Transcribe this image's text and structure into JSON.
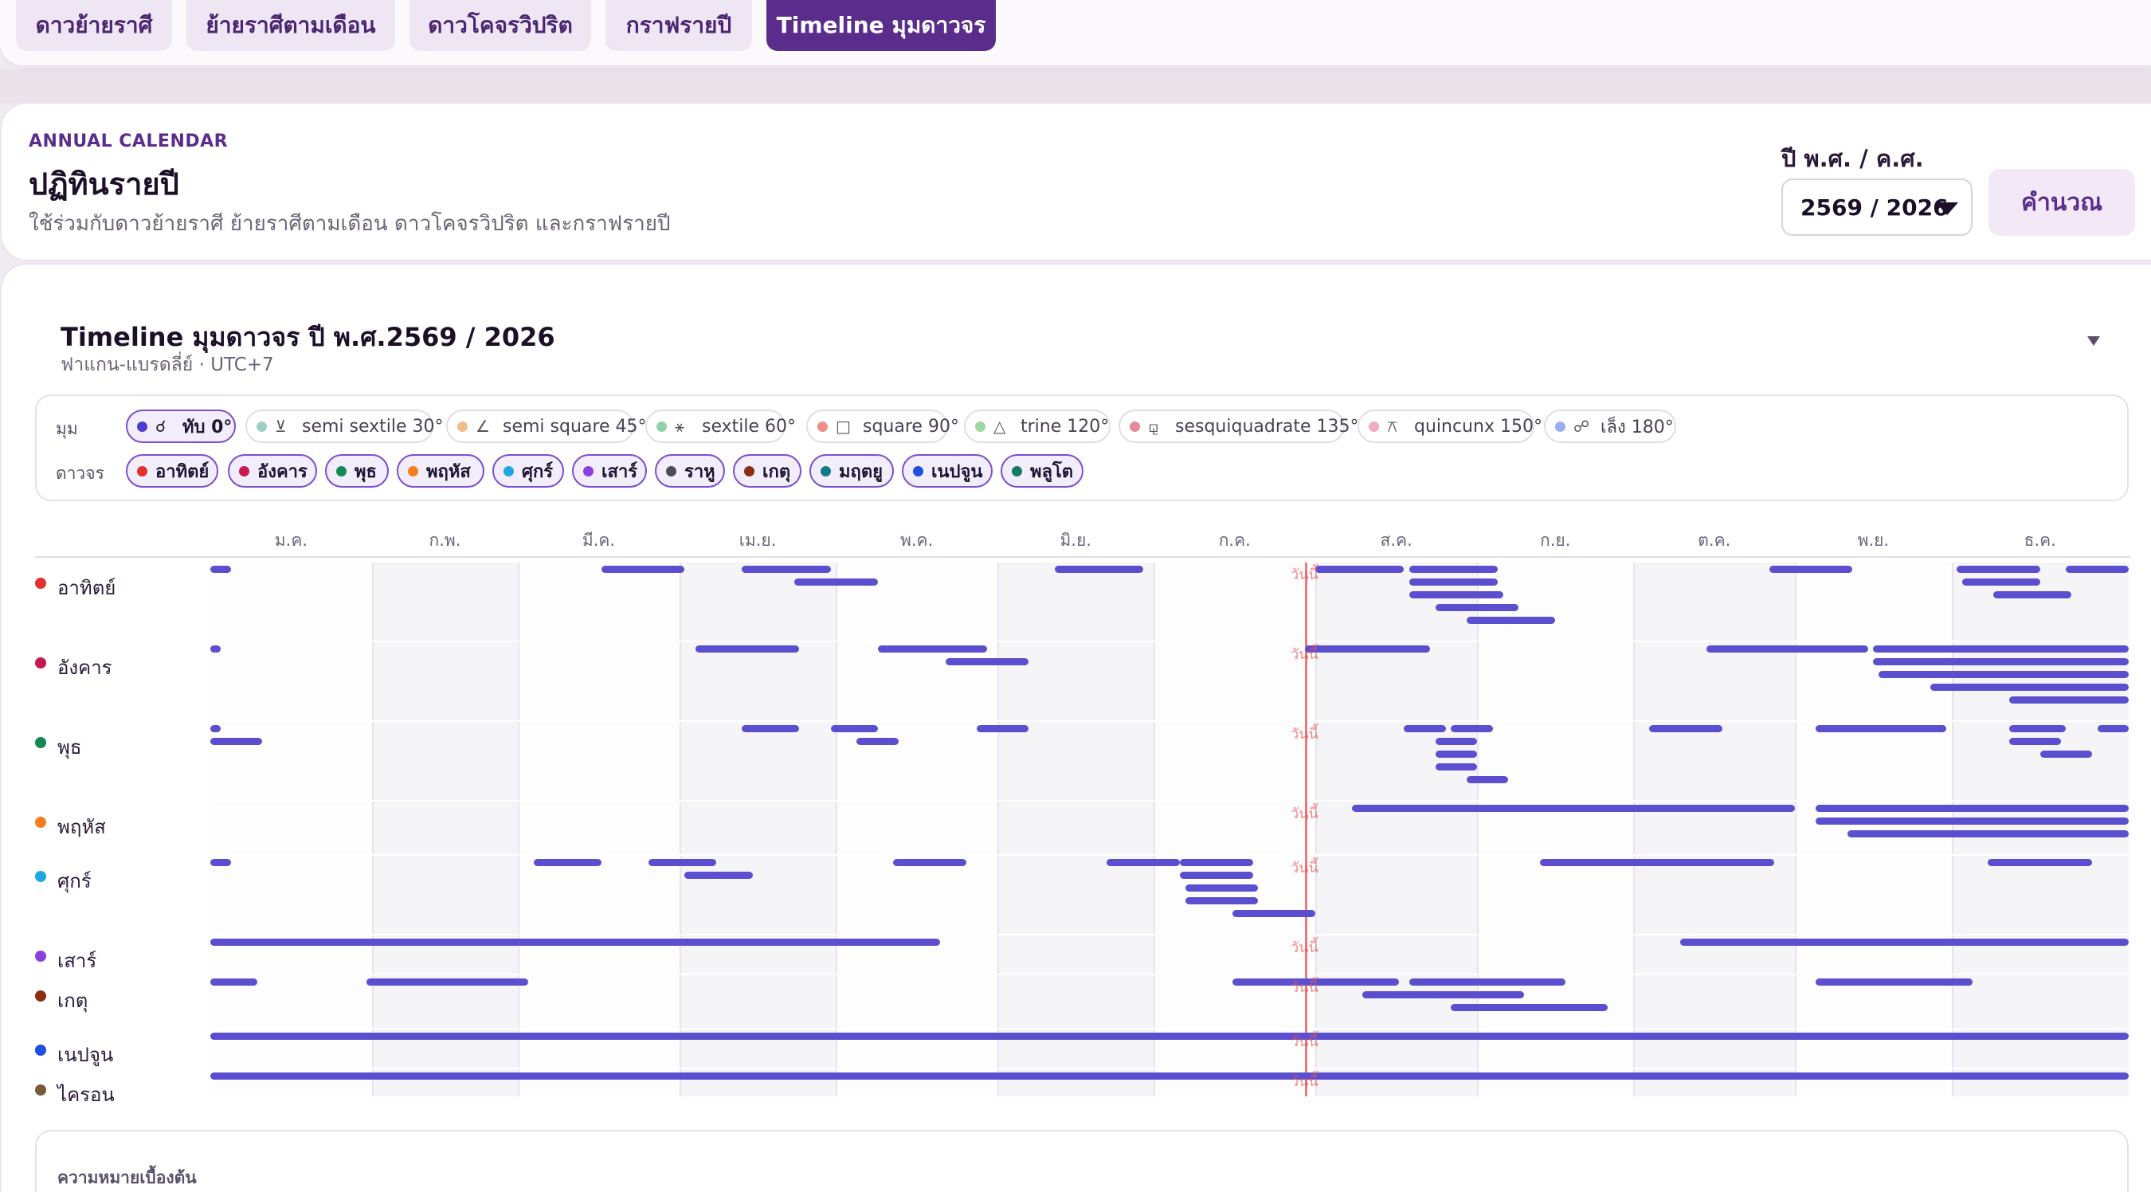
{
  "tabs": [
    {
      "label": "ดาวย้ายราศี",
      "active": false
    },
    {
      "label": "ย้ายราศีตามเดือน",
      "active": false
    },
    {
      "label": "ดาวโคจรวิปริต",
      "active": false
    },
    {
      "label": "กราฟรายปี",
      "active": false
    },
    {
      "label": "Timeline มุมดาวจร",
      "active": true
    }
  ],
  "header": {
    "eyebrow": "ANNUAL CALENDAR",
    "title": "ปฏิทินรายปี",
    "subtitle": "ใช้ร่วมกับดาวย้ายราศี ย้ายราศีตามเดือน ดาวโคจรวิปริต และกราฟรายปี",
    "year_label": "ปี พ.ศ. / ค.ศ.",
    "year_value": "2569 / 2026",
    "calc_button": "คำนวณ"
  },
  "timeline": {
    "title": "Timeline มุมดาวจร ปี พ.ศ.2569 / 2026",
    "subtitle": "ฟาแกน-แบรดลี่ย์ · UTC+7",
    "today_label": "วันนี้",
    "bar_color": "#5b4fcf",
    "today_color": "#e8575a"
  },
  "filters": {
    "aspect_label": "มุม",
    "planet_label": "ดาวจร",
    "aspects": [
      {
        "label": "ทับ 0°",
        "symbol": "☌",
        "color": "#4b3bd1",
        "selected": true
      },
      {
        "label": "semi sextile 30°",
        "symbol": "⊻",
        "color": "#9fd0c4",
        "selected": false
      },
      {
        "label": "semi square 45°",
        "symbol": "∠",
        "color": "#f2bc8c",
        "selected": false
      },
      {
        "label": "sextile 60°",
        "symbol": "⚹",
        "color": "#8fd2a8",
        "selected": false
      },
      {
        "label": "square 90°",
        "symbol": "□",
        "color": "#ef8f86",
        "selected": false
      },
      {
        "label": "trine 120°",
        "symbol": "△",
        "color": "#9ed7a2",
        "selected": false
      },
      {
        "label": "sesquiquadrate 135°",
        "symbol": "⚼",
        "color": "#e38a98",
        "selected": false
      },
      {
        "label": "quincunx 150°",
        "symbol": "⚻",
        "color": "#f5a7c6",
        "selected": false
      },
      {
        "label": "เล็ง 180°",
        "symbol": "☍",
        "color": "#9aaef0",
        "selected": false
      }
    ],
    "planets": [
      {
        "label": "อาทิตย์",
        "color": "#e0322b"
      },
      {
        "label": "อังคาร",
        "color": "#c8174e"
      },
      {
        "label": "พุธ",
        "color": "#138a52"
      },
      {
        "label": "พฤหัส",
        "color": "#f57f1f"
      },
      {
        "label": "ศุกร์",
        "color": "#1ea7e1"
      },
      {
        "label": "เสาร์",
        "color": "#8a3fe0"
      },
      {
        "label": "ราหู",
        "color": "#4b4b55"
      },
      {
        "label": "เกตุ",
        "color": "#8a2d12"
      },
      {
        "label": "มฤตยู",
        "color": "#137a8c"
      },
      {
        "label": "เนปจูน",
        "color": "#1f4fe0"
      },
      {
        "label": "พลูโต",
        "color": "#137a62"
      }
    ]
  },
  "chart_data": {
    "type": "timeline",
    "year": 2026,
    "months": [
      "ม.ค.",
      "ก.พ.",
      "มี.ค.",
      "เม.ย.",
      "พ.ค.",
      "มิ.ย.",
      "ก.ค.",
      "ส.ค.",
      "ก.ย.",
      "ต.ค.",
      "พ.ย.",
      "ธ.ค."
    ],
    "today_doy": 210,
    "rows": [
      {
        "label": "อาทิตย์",
        "color": "#e0322b",
        "bars": [
          [
            0,
            4
          ],
          [
            75,
            91
          ],
          [
            102,
            119
          ],
          [
            112,
            128
          ],
          [
            162,
            179
          ],
          [
            212,
            229
          ],
          [
            230,
            247
          ],
          [
            230,
            247
          ],
          [
            230,
            248
          ],
          [
            235,
            251
          ],
          [
            241,
            258
          ],
          [
            299,
            315
          ],
          [
            335,
            351
          ],
          [
            336,
            351
          ],
          [
            342,
            357
          ],
          [
            356,
            368
          ]
        ]
      },
      {
        "label": "อังคาร",
        "color": "#c8174e",
        "bars": [
          [
            0,
            2
          ],
          [
            93,
            113
          ],
          [
            128,
            149
          ],
          [
            141,
            157
          ],
          [
            210,
            234
          ],
          [
            287,
            318
          ],
          [
            319,
            368
          ],
          [
            319,
            368
          ],
          [
            320,
            368
          ],
          [
            330,
            368
          ],
          [
            345,
            368
          ]
        ]
      },
      {
        "label": "พุธ",
        "color": "#138a52",
        "bars": [
          [
            0,
            2
          ],
          [
            0,
            10
          ],
          [
            102,
            113
          ],
          [
            119,
            128
          ],
          [
            124,
            132
          ],
          [
            147,
            157
          ],
          [
            229,
            237
          ],
          [
            238,
            246
          ],
          [
            235,
            243
          ],
          [
            235,
            243
          ],
          [
            235,
            243
          ],
          [
            241,
            249
          ],
          [
            276,
            290
          ],
          [
            308,
            333
          ],
          [
            345,
            356
          ],
          [
            345,
            355
          ],
          [
            351,
            361
          ],
          [
            362,
            368
          ]
        ]
      },
      {
        "label": "พฤหัส",
        "color": "#f57f1f",
        "bars": [
          [
            219,
            304
          ],
          [
            308,
            368
          ],
          [
            308,
            368
          ],
          [
            314,
            368
          ]
        ]
      },
      {
        "label": "ศุกร์",
        "color": "#1ea7e1",
        "bars": [
          [
            0,
            4
          ],
          [
            62,
            75
          ],
          [
            84,
            97
          ],
          [
            91,
            104
          ],
          [
            131,
            145
          ],
          [
            172,
            186
          ],
          [
            186,
            200
          ],
          [
            186,
            200
          ],
          [
            187,
            201
          ],
          [
            187,
            201
          ],
          [
            196,
            212
          ],
          [
            255,
            300
          ],
          [
            341,
            361
          ]
        ]
      },
      {
        "label": "เสาร์",
        "color": "#8a3fe0",
        "bars": [
          [
            0,
            140
          ],
          [
            282,
            368
          ]
        ]
      },
      {
        "label": "เกตุ",
        "color": "#8a2d12",
        "bars": [
          [
            0,
            9
          ],
          [
            30,
            61
          ],
          [
            196,
            228
          ],
          [
            230,
            260
          ],
          [
            221,
            252
          ],
          [
            238,
            268
          ],
          [
            308,
            338
          ]
        ]
      },
      {
        "label": "เนปจูน",
        "color": "#1f4fe0",
        "bars": [
          [
            0,
            368
          ]
        ]
      },
      {
        "label": "ไครอน",
        "color": "#7a5a3a",
        "bars": [
          [
            0,
            368
          ]
        ]
      }
    ]
  },
  "footer": {
    "title": "ความหมายเบื้องต้น"
  }
}
